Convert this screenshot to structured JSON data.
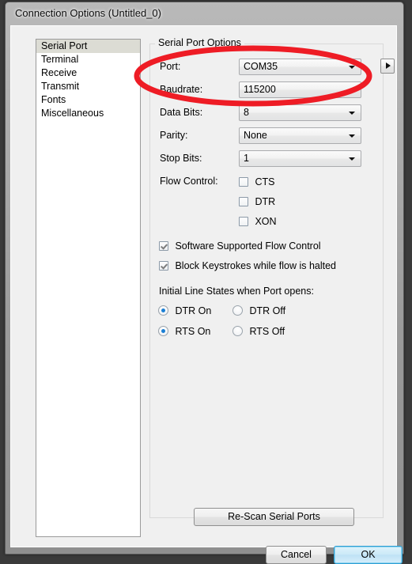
{
  "window": {
    "title": "Connection Options (Untitled_0)"
  },
  "sidebar": {
    "items": [
      {
        "label": "Serial Port",
        "selected": true
      },
      {
        "label": "Terminal",
        "selected": false
      },
      {
        "label": "Receive",
        "selected": false
      },
      {
        "label": "Transmit",
        "selected": false
      },
      {
        "label": "Fonts",
        "selected": false
      },
      {
        "label": "Miscellaneous",
        "selected": false
      }
    ]
  },
  "group": {
    "legend": "Serial Port Options"
  },
  "fields": {
    "port": {
      "label": "Port:",
      "value": "COM35"
    },
    "baudrate": {
      "label": "Baudrate:",
      "value": "115200"
    },
    "data_bits": {
      "label": "Data Bits:",
      "value": "8"
    },
    "parity": {
      "label": "Parity:",
      "value": "None"
    },
    "stop_bits": {
      "label": "Stop Bits:",
      "value": "1"
    }
  },
  "port_next_button": {
    "icon": "triangle-right-icon"
  },
  "flow_control": {
    "label": "Flow Control:",
    "options": [
      {
        "label": "CTS",
        "checked": false
      },
      {
        "label": "DTR",
        "checked": false
      },
      {
        "label": "XON",
        "checked": false
      }
    ]
  },
  "extra_checkboxes": [
    {
      "label": "Software Supported Flow Control",
      "checked": true
    },
    {
      "label": "Block Keystrokes while flow is halted",
      "checked": true
    }
  ],
  "initial_line_states": {
    "label": "Initial Line States when Port opens:",
    "options": [
      {
        "label": "DTR On",
        "selected": true
      },
      {
        "label": "DTR Off",
        "selected": false
      },
      {
        "label": "RTS On",
        "selected": true
      },
      {
        "label": "RTS Off",
        "selected": false
      }
    ]
  },
  "buttons": {
    "rescan": "Re-Scan Serial Ports",
    "cancel": "Cancel",
    "ok": "OK"
  },
  "annotation": {
    "shape": "ellipse",
    "color": "#ee1c25",
    "stroke_width": 7
  }
}
